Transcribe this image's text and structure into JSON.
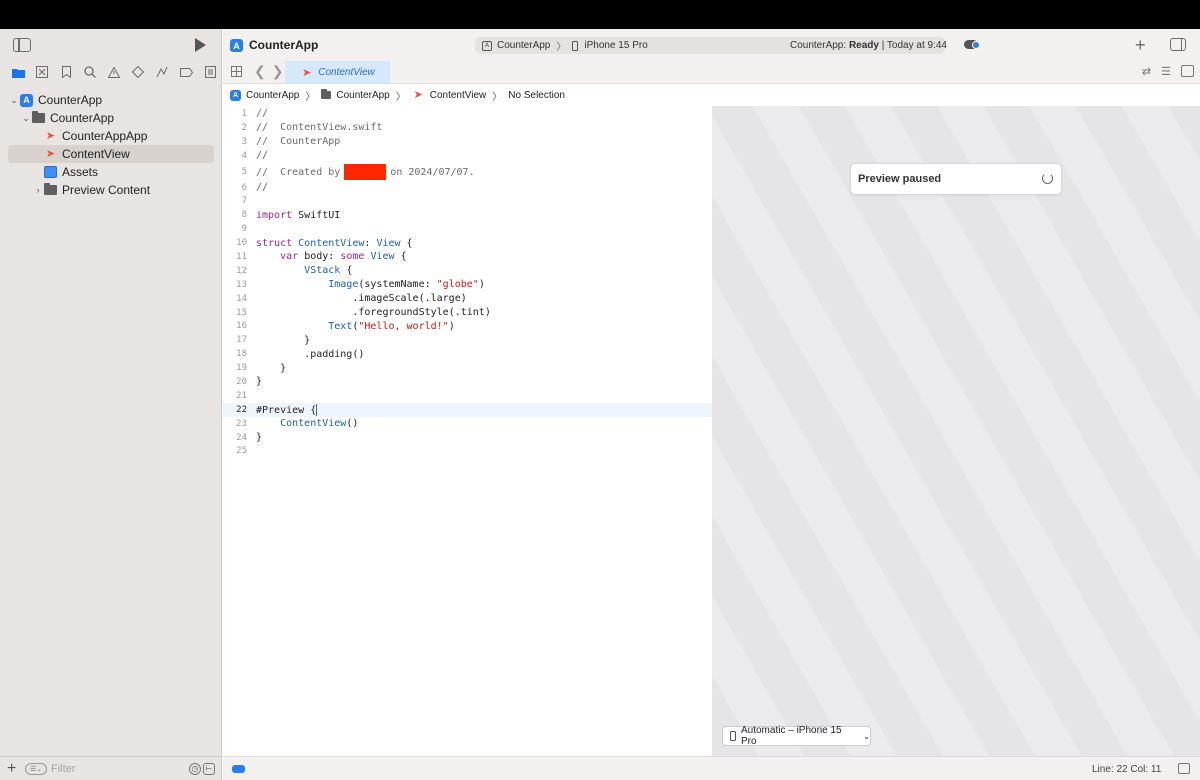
{
  "window": {
    "app_title": "CounterApp",
    "scheme": {
      "target": "CounterApp",
      "device": "iPhone 15 Pro"
    },
    "status": {
      "prefix": "CounterApp: ",
      "state": "Ready",
      "suffix": " | Today at 9:44"
    }
  },
  "sidebar": {
    "tree": [
      {
        "label": "CounterApp",
        "kind": "app",
        "level": 0,
        "expanded": true
      },
      {
        "label": "CounterApp",
        "kind": "folder",
        "level": 1,
        "expanded": true
      },
      {
        "label": "CounterAppApp",
        "kind": "swift",
        "level": 2
      },
      {
        "label": "ContentView",
        "kind": "swift",
        "level": 2,
        "selected": true
      },
      {
        "label": "Assets",
        "kind": "assets",
        "level": 2
      },
      {
        "label": "Preview Content",
        "kind": "folder",
        "level": 2,
        "expanded": false
      }
    ],
    "filter_placeholder": "Filter"
  },
  "tabbar": {
    "active_tab": "ContentView"
  },
  "jumpbar": {
    "project": "CounterApp",
    "group": "CounterApp",
    "file": "ContentView",
    "symbol": "No Selection"
  },
  "editor": {
    "lines": [
      {
        "n": "1",
        "text": "//"
      },
      {
        "n": "2",
        "text": "//  ContentView.swift"
      },
      {
        "n": "3",
        "text": "//  CounterApp"
      },
      {
        "n": "4",
        "text": "//"
      },
      {
        "n": "5",
        "text_before": "//  Created by",
        "text_after": "on 2024/07/07."
      },
      {
        "n": "6",
        "text": "//"
      },
      {
        "n": "7",
        "text": ""
      },
      {
        "n": "8",
        "text": "import SwiftUI"
      },
      {
        "n": "9",
        "text": ""
      },
      {
        "n": "10",
        "text": "struct ContentView: View {"
      },
      {
        "n": "11",
        "text": "    var body: some View {"
      },
      {
        "n": "12",
        "text": "        VStack {"
      },
      {
        "n": "13",
        "text": "            Image(systemName: \"globe\")"
      },
      {
        "n": "14",
        "text": "                .imageScale(.large)"
      },
      {
        "n": "15",
        "text": "                .foregroundStyle(.tint)"
      },
      {
        "n": "16",
        "text": "            Text(\"Hello, world!\")"
      },
      {
        "n": "17",
        "text": "        }"
      },
      {
        "n": "18",
        "text": "        .padding()"
      },
      {
        "n": "19",
        "text": "    }"
      },
      {
        "n": "20",
        "text": "}"
      },
      {
        "n": "21",
        "text": ""
      },
      {
        "n": "22",
        "text": "#Preview {"
      },
      {
        "n": "23",
        "text": "    ContentView()"
      },
      {
        "n": "24",
        "text": "}"
      },
      {
        "n": "25",
        "text": ""
      }
    ],
    "current_line": "22"
  },
  "preview": {
    "card_label": "Preview paused",
    "device_button": "Automatic – iPhone 15 Pro"
  },
  "statusbar": {
    "line_col": "Line: 22  Col: 11"
  },
  "colors": {
    "accent": "#2a7cf0",
    "swift": "#f05138",
    "keyword": "#9b2393",
    "type": "#1c5fb3",
    "string": "#c41a16",
    "redaction": "#ff2600"
  }
}
